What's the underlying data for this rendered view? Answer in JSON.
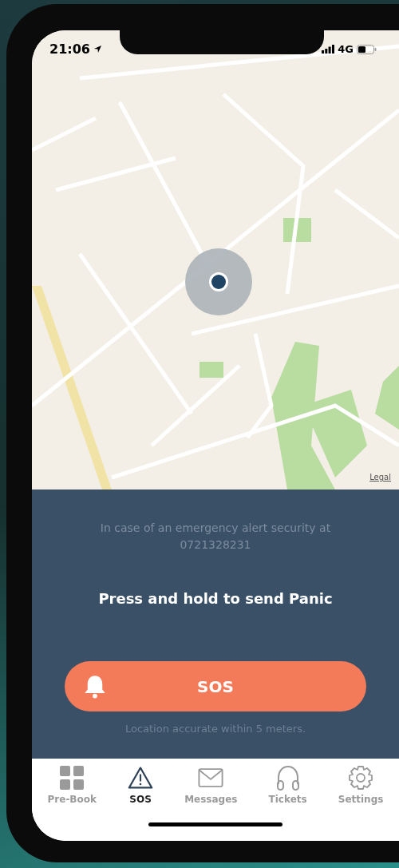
{
  "status_bar": {
    "time": "21:06",
    "network": "4G"
  },
  "map": {
    "legal_link": "Legal"
  },
  "panel": {
    "notice": "In case of an emergency alert security at 0721328231",
    "instruction": "Press and hold to send Panic",
    "sos_button": "SOS",
    "accuracy": "Location accurate within 5 meters."
  },
  "tabs": [
    {
      "label": "Pre-Book",
      "kind": "grid",
      "selected": false
    },
    {
      "label": "SOS",
      "kind": "warning",
      "selected": true
    },
    {
      "label": "Messages",
      "kind": "mail",
      "selected": false
    },
    {
      "label": "Tickets",
      "kind": "headset",
      "selected": false
    },
    {
      "label": "Settings",
      "kind": "gear",
      "selected": false
    }
  ]
}
